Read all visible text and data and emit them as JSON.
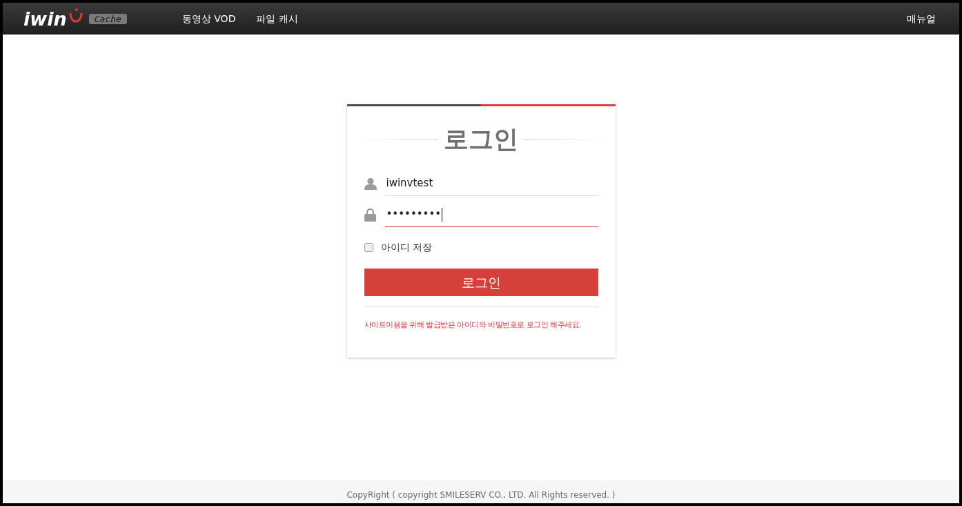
{
  "header": {
    "logo": {
      "text": "iwin",
      "badge": "Cache"
    },
    "nav": [
      {
        "label": "동영상 VOD"
      },
      {
        "label": "파일 캐시"
      }
    ],
    "manual_link": "매뉴얼"
  },
  "login": {
    "title": "로그인",
    "username": {
      "value": "iwinvtest",
      "focused": false
    },
    "password": {
      "value": "•••••••••",
      "focused": true
    },
    "remember": {
      "label": "아이디 저장",
      "checked": false
    },
    "submit": "로그인",
    "notice": "사이트이용을 위해 발급받은 아이디와 비밀번호로 로그인 해주세요."
  },
  "footer": "CopyRight ( copyright SMILESERV CO., LTD. All Rights reserved. )"
}
